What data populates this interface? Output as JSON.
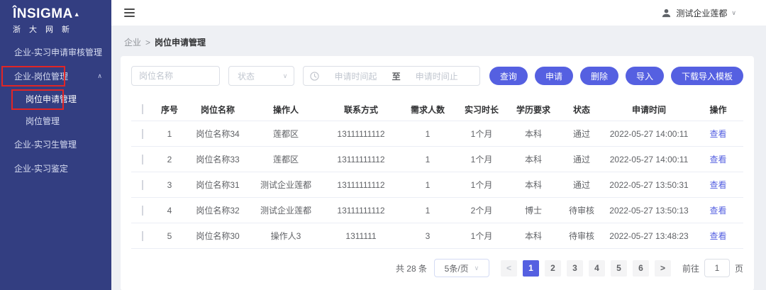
{
  "colors": {
    "sidebar_bg": "#333e81",
    "accent": "#5560e1",
    "annotation_red": "#e12525",
    "page_bg": "#eef0f4",
    "link": "#5560e1"
  },
  "icons": {
    "chevron_up": "∧",
    "chevron_down": "∨",
    "logo_triangle": "▲",
    "prev_arrow": "<",
    "next_arrow": ">"
  },
  "brand": {
    "logo_text": "ÎNSIGMA",
    "logo_subtitle": "浙大网新"
  },
  "sidebar": {
    "items": [
      {
        "label": "企业-实习申请审核管理",
        "type": "top",
        "chevron": null,
        "active": false,
        "annotated": false
      },
      {
        "label": "企业-岗位管理",
        "type": "top",
        "chevron": "up",
        "active": false,
        "annotated": true
      },
      {
        "label": "岗位申请管理",
        "type": "sub",
        "chevron": null,
        "active": true,
        "annotated": true
      },
      {
        "label": "岗位管理",
        "type": "sub",
        "chevron": null,
        "active": false,
        "annotated": false
      },
      {
        "label": "企业-实习生管理",
        "type": "top",
        "chevron": null,
        "active": false,
        "annotated": false
      },
      {
        "label": "企业-实习鉴定",
        "type": "top",
        "chevron": null,
        "active": false,
        "annotated": false
      }
    ]
  },
  "topbar": {
    "user_name": "测试企业莲都"
  },
  "breadcrumb": {
    "parent": "企业",
    "separator": ">",
    "current": "岗位申请管理"
  },
  "filters": {
    "keyword_placeholder": "岗位名称",
    "status_placeholder": "状态",
    "date_start_placeholder": "申请时间起",
    "date_separator": "至",
    "date_end_placeholder": "申请时间止"
  },
  "toolbar": {
    "buttons": [
      "查询",
      "申请",
      "删除",
      "导入",
      "下载导入模板"
    ]
  },
  "table": {
    "columns": [
      "序号",
      "岗位名称",
      "操作人",
      "联系方式",
      "需求人数",
      "实习时长",
      "学历要求",
      "状态",
      "申请时间",
      "操作"
    ],
    "rows": [
      {
        "seq": "1",
        "name": "岗位名称34",
        "operator": "莲都区",
        "contact": "13111111112",
        "headcount": "1",
        "duration": "1个月",
        "education": "本科",
        "status": "通过",
        "apply_time": "2022-05-27 14:00:11",
        "action": "查看"
      },
      {
        "seq": "2",
        "name": "岗位名称33",
        "operator": "莲都区",
        "contact": "13111111112",
        "headcount": "1",
        "duration": "1个月",
        "education": "本科",
        "status": "通过",
        "apply_time": "2022-05-27 14:00:11",
        "action": "查看"
      },
      {
        "seq": "3",
        "name": "岗位名称31",
        "operator": "测试企业莲都",
        "contact": "13111111112",
        "headcount": "1",
        "duration": "1个月",
        "education": "本科",
        "status": "通过",
        "apply_time": "2022-05-27 13:50:31",
        "action": "查看"
      },
      {
        "seq": "4",
        "name": "岗位名称32",
        "operator": "测试企业莲都",
        "contact": "13111111112",
        "headcount": "1",
        "duration": "2个月",
        "education": "博士",
        "status": "待审核",
        "apply_time": "2022-05-27 13:50:13",
        "action": "查看"
      },
      {
        "seq": "5",
        "name": "岗位名称30",
        "operator": "操作人3",
        "contact": "1311111",
        "headcount": "3",
        "duration": "1个月",
        "education": "本科",
        "status": "待审核",
        "apply_time": "2022-05-27 13:48:23",
        "action": "查看"
      }
    ]
  },
  "pagination": {
    "total_text": "共 28 条",
    "page_size_text": "5条/页",
    "pages": [
      "1",
      "2",
      "3",
      "4",
      "5",
      "6"
    ],
    "active_page": "1",
    "goto_label": "前往",
    "goto_value": "1",
    "goto_unit": "页"
  }
}
